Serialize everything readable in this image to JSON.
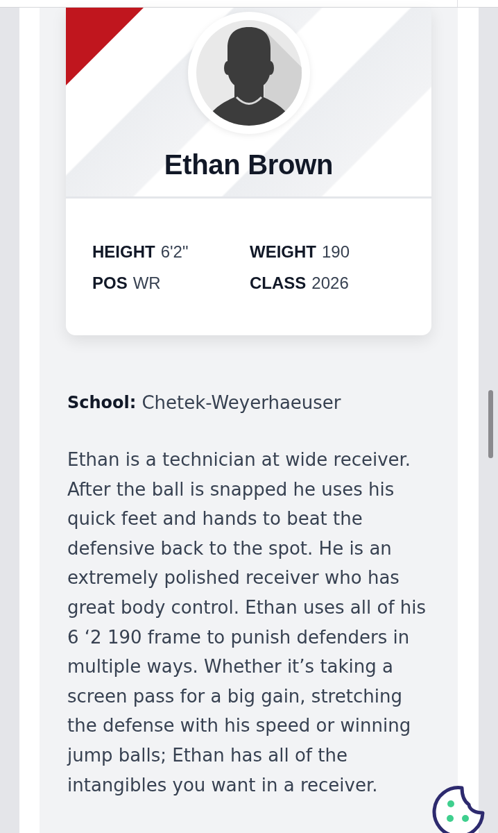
{
  "player": {
    "name": "Ethan Brown",
    "stats": [
      {
        "label": "HEIGHT",
        "value": "6'2\""
      },
      {
        "label": "WEIGHT",
        "value": "190"
      },
      {
        "label": "POS",
        "value": "WR"
      },
      {
        "label": "CLASS",
        "value": "2026"
      }
    ]
  },
  "school": {
    "label": "School:",
    "value": "Chetek-Weyerhaeuser"
  },
  "bio": "Ethan is a technician at wide receiver. After the ball is snapped he uses his quick feet and hands to beat the defensive back to the spot. He is an extremely polished receiver who has great body control. Ethan uses all of his 6 ‘2 190 frame to punish defenders in multiple ways. Whether it’s taking a screen pass for a big gain, stretching the defense with his speed or winning jump balls; Ethan has all of the intangibles you want in a receiver."
}
